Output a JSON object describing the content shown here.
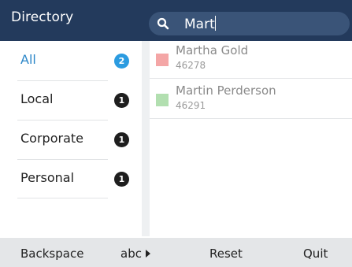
{
  "header": {
    "title": "Directory",
    "search": {
      "value": "Mart",
      "icon": "search-icon"
    }
  },
  "categories": [
    {
      "label": "All",
      "count": "2",
      "active": true
    },
    {
      "label": "Local",
      "count": "1",
      "active": false
    },
    {
      "label": "Corporate",
      "count": "1",
      "active": false
    },
    {
      "label": "Personal",
      "count": "1",
      "active": false
    }
  ],
  "results": [
    {
      "name": "Martha Gold",
      "number": "46278",
      "color": "#f4a6a6"
    },
    {
      "name": "Martin Perderson",
      "number": "46291",
      "color": "#b2dfb0"
    }
  ],
  "softkeys": {
    "backspace": "Backspace",
    "abc": "abc",
    "reset": "Reset",
    "quit": "Quit"
  },
  "colors": {
    "header_bg": "#233a5c",
    "accent": "#2b86c8",
    "badge_active": "#2b9be0"
  }
}
